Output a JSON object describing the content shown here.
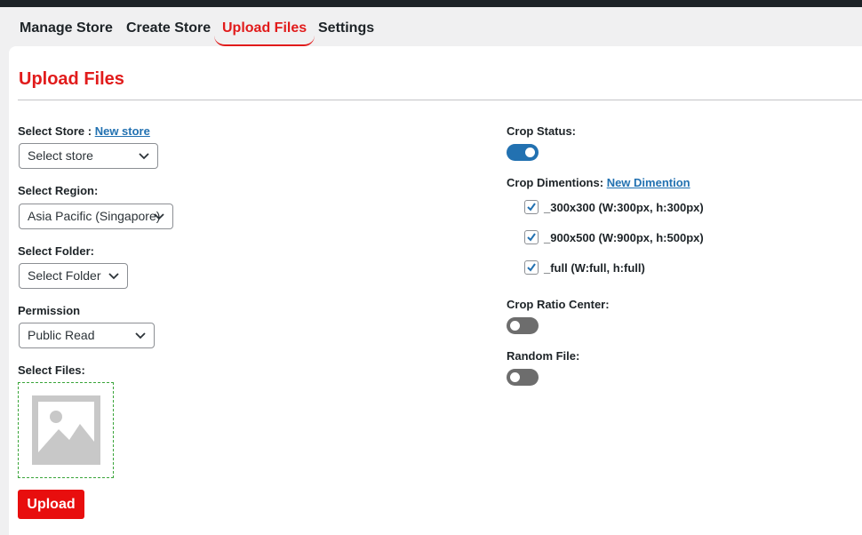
{
  "tabs": [
    {
      "label": "Manage Store"
    },
    {
      "label": "Create Store"
    },
    {
      "label": "Upload Files"
    },
    {
      "label": "Settings"
    }
  ],
  "page": {
    "title": "Upload Files"
  },
  "form": {
    "store": {
      "label": "Select Store :",
      "link": "New store",
      "value": "Select store"
    },
    "region": {
      "label": "Select Region:",
      "value": "Asia Pacific (Singapore)"
    },
    "folder": {
      "label": "Select Folder:",
      "value": "Select Folder"
    },
    "permission": {
      "label": "Permission",
      "value": "Public Read"
    },
    "files": {
      "label": "Select Files:"
    },
    "upload_label": "Upload"
  },
  "crop": {
    "status_label": "Crop Status:",
    "status_on": true,
    "dimensions_label": "Crop Dimentions:",
    "dimensions_link": "New Dimention",
    "dimensions": [
      {
        "label": "_300x300 (W:300px, h:300px)",
        "checked": true
      },
      {
        "label": "_900x500 (W:900px, h:500px)",
        "checked": true
      },
      {
        "label": "_full (W:full, h:full)",
        "checked": true
      }
    ],
    "ratio_center_label": "Crop Ratio Center:",
    "ratio_center_on": false,
    "random_file_label": "Random File:",
    "random_file_on": false
  },
  "colors": {
    "accent": "#e11b1b",
    "toggle_on": "#2271b1",
    "link": "#2271b1"
  },
  "icons": {
    "select_chevron": "chevron-down-icon",
    "file_placeholder": "image-placeholder-icon",
    "checkbox_check": "checkmark-icon"
  }
}
